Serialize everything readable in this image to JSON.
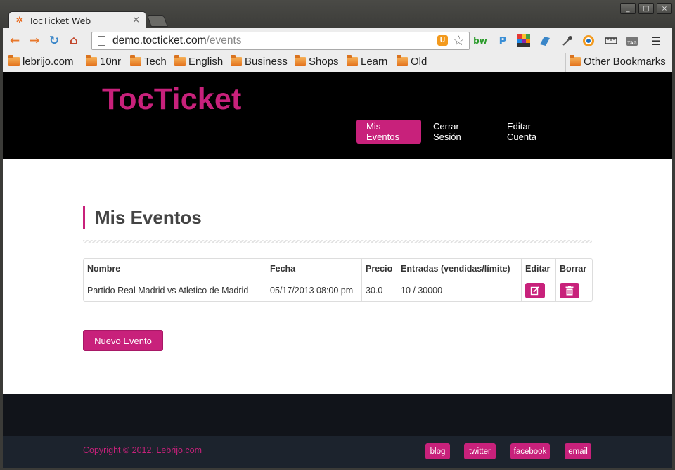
{
  "browser": {
    "tab_title": "TocTicket Web",
    "tab_close": "×",
    "url_host": "demo.tocticket.com",
    "url_path": "/events",
    "window_controls": [
      "_",
      "□",
      "×"
    ],
    "bookmarks": [
      "lebrijo.com",
      "10nr",
      "Tech",
      "English",
      "Business",
      "Shops",
      "Learn",
      "Old"
    ],
    "other_bookmarks": "Other Bookmarks"
  },
  "site": {
    "logo": "TocTicket",
    "nav": [
      "Mis Eventos",
      "Cerrar Sesión",
      "Editar Cuenta"
    ],
    "active_nav": "Mis Eventos",
    "accent_color": "#c8217b"
  },
  "main": {
    "title": "Mis Eventos",
    "table": {
      "headers": [
        "Nombre",
        "Fecha",
        "Precio",
        "Entradas (vendidas/límite)",
        "Editar",
        "Borrar"
      ],
      "rows": [
        {
          "nombre": "Partido Real Madrid vs Atletico de Madrid",
          "fecha": "05/17/2013 08:00 pm",
          "precio": "30.0",
          "entradas": "10 / 30000",
          "edit_icon": "edit-icon",
          "delete_icon": "trash-icon"
        }
      ]
    },
    "new_button": "Nuevo Evento"
  },
  "footer": {
    "copyright": "Copyright © 2012. Lebrijo.com",
    "links": [
      "blog",
      "twitter",
      "facebook",
      "email"
    ]
  }
}
